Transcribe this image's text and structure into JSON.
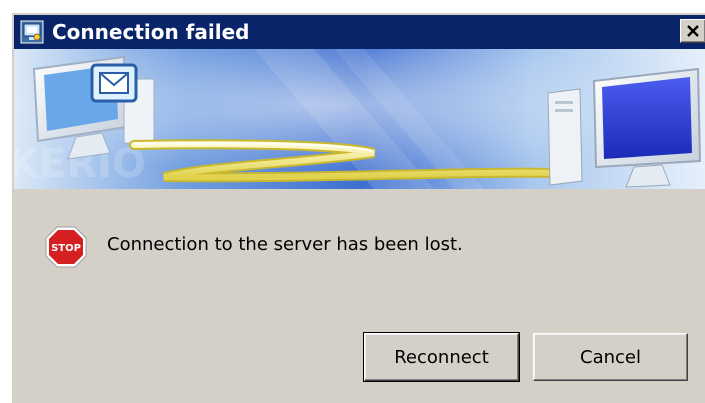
{
  "window": {
    "title": "Connection failed",
    "title_icon": "app-window-icon",
    "close_label": "Close"
  },
  "banner": {
    "description_icons": [
      "mail-monitor-icon",
      "desktop-computer-icon"
    ],
    "watermark": "KERIO"
  },
  "message": {
    "icon": "stop-icon",
    "icon_label": "STOP",
    "text": "Connection to the server has been lost."
  },
  "buttons": {
    "reconnect_label": "Reconnect",
    "cancel_label": "Cancel"
  },
  "colors": {
    "titlebar": "#0a246a",
    "dialog_bg": "#d4d0c8",
    "stop_red": "#d42020"
  }
}
